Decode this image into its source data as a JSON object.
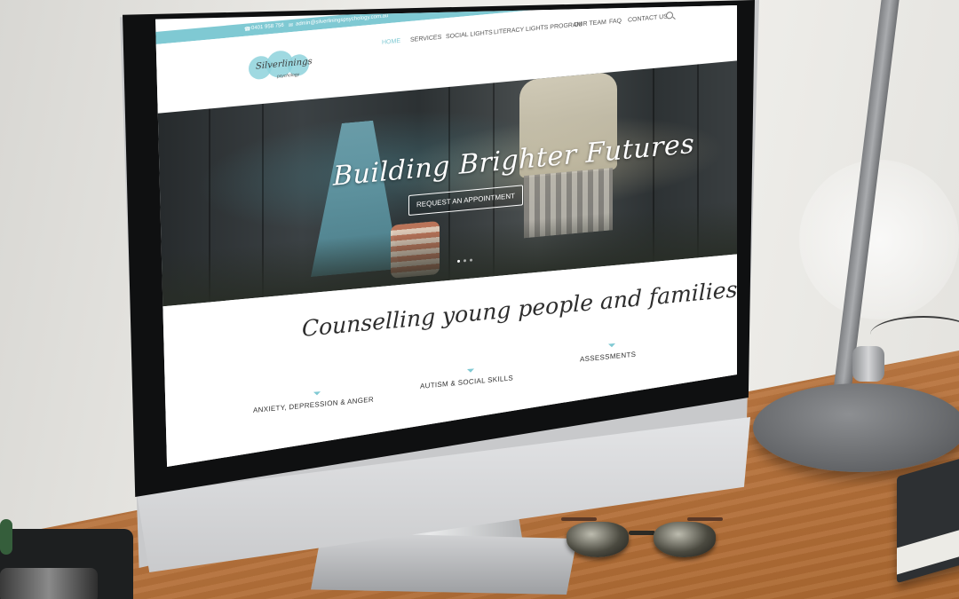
{
  "website": {
    "contact": {
      "phone": "0401 958 756",
      "email": "admin@silverliningspsychology.com.au"
    },
    "logo": {
      "name": "Silverlinings",
      "sub": "psychology"
    },
    "nav": {
      "items": [
        {
          "label": "HOME",
          "active": true
        },
        {
          "label": "SERVICES",
          "active": false
        },
        {
          "label": "SOCIAL LIGHTS",
          "active": false
        },
        {
          "label": "LITERACY LIGHTS PROGRAM",
          "active": false
        },
        {
          "label": "OUR TEAM",
          "active": false
        },
        {
          "label": "FAQ",
          "active": false
        },
        {
          "label": "CONTACT US",
          "active": false
        }
      ]
    },
    "hero": {
      "title": "Building Brighter Futures",
      "cta_label": "REQUEST AN APPOINTMENT",
      "slides": 3,
      "active_slide": 1
    },
    "tagline": "Counselling young people and families",
    "services": [
      "ANXIETY, DEPRESSION & ANGER",
      "AUTISM & SOCIAL SKILLS",
      "ASSESSMENTS"
    ]
  },
  "colors": {
    "accent": "#7fc9d3",
    "hero_text": "#ffffff",
    "desk": "#b8743e"
  }
}
